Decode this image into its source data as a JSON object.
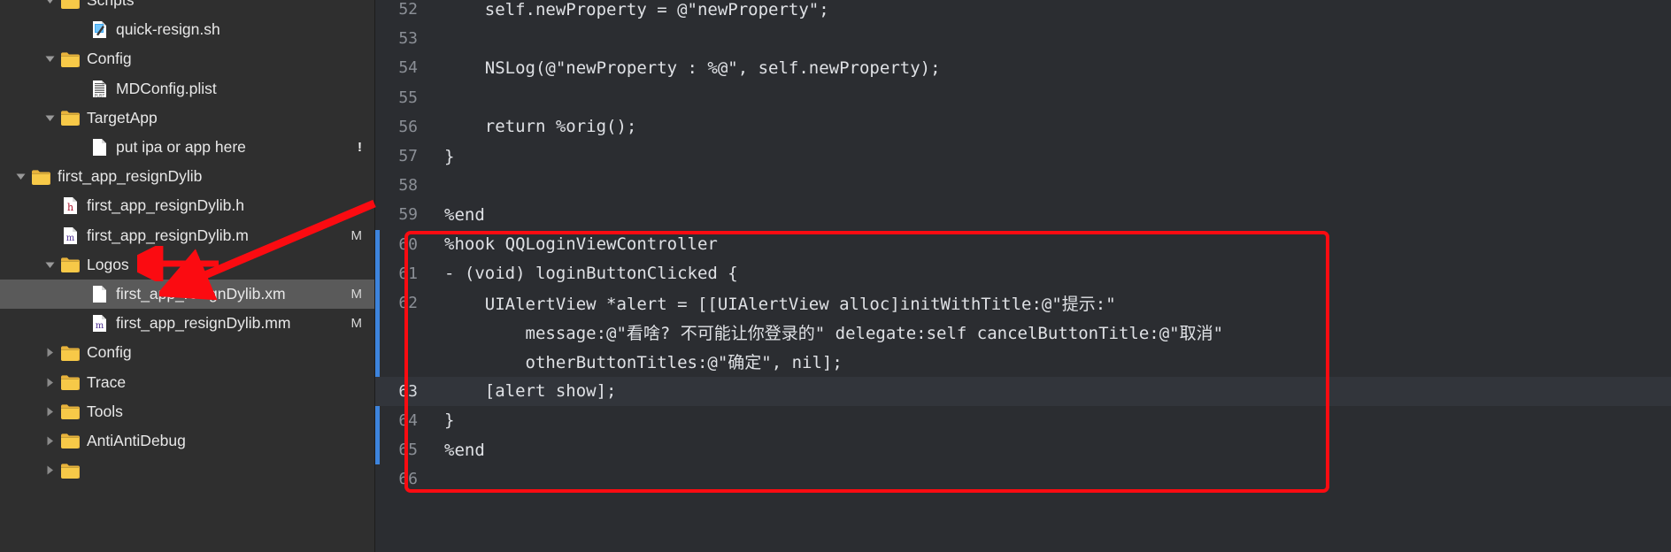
{
  "window": {
    "theme": "dark",
    "sidebar_bg": "#2f2f2f",
    "editor_bg": "#2b2d31",
    "accent_red": "#fb0b11",
    "accent_blue": "#3d84dd",
    "selection_bg": "#5a5a5a"
  },
  "sidebar": {
    "name": "project-file-tree",
    "items": [
      {
        "label": "Scripts",
        "indent": 1,
        "type": "folder",
        "twisty": "down",
        "icon": "folder-icon",
        "badge": "",
        "selected": false,
        "clipped_top": true
      },
      {
        "label": "quick-resign.sh",
        "indent": 2,
        "type": "file-sh",
        "twisty": "none",
        "icon": "shell-script-icon",
        "badge": "",
        "selected": false
      },
      {
        "label": "Config",
        "indent": 1,
        "type": "folder",
        "twisty": "down",
        "icon": "folder-icon",
        "badge": "",
        "selected": false
      },
      {
        "label": "MDConfig.plist",
        "indent": 2,
        "type": "file-plist",
        "twisty": "none",
        "icon": "plist-file-icon",
        "badge": "",
        "selected": false
      },
      {
        "label": "TargetApp",
        "indent": 1,
        "type": "folder",
        "twisty": "down",
        "icon": "folder-icon",
        "badge": "",
        "selected": false
      },
      {
        "label": "put ipa or app here",
        "indent": 2,
        "type": "file-plain",
        "twisty": "none",
        "icon": "blank-file-icon",
        "badge": "!",
        "selected": false
      },
      {
        "label": "first_app_resignDylib",
        "indent": 0,
        "type": "folder",
        "twisty": "down",
        "icon": "folder-icon",
        "badge": "",
        "selected": false
      },
      {
        "label": "first_app_resignDylib.h",
        "indent": 1,
        "type": "file-h",
        "twisty": "none",
        "icon": "header-file-icon",
        "badge": "",
        "selected": false
      },
      {
        "label": "first_app_resignDylib.m",
        "indent": 1,
        "type": "file-m",
        "twisty": "none",
        "icon": "objc-file-icon",
        "badge": "M",
        "selected": false
      },
      {
        "label": "Logos",
        "indent": 1,
        "type": "folder",
        "twisty": "down",
        "icon": "folder-icon",
        "badge": "",
        "selected": false
      },
      {
        "label": "first_app_resignDylib.xm",
        "indent": 2,
        "type": "file-plain",
        "twisty": "none",
        "icon": "blank-file-icon",
        "badge": "M",
        "selected": true
      },
      {
        "label": "first_app_resignDylib.mm",
        "indent": 2,
        "type": "file-mm",
        "twisty": "none",
        "icon": "objcpp-file-icon",
        "badge": "M",
        "selected": false
      },
      {
        "label": "Config",
        "indent": 1,
        "type": "folder",
        "twisty": "right",
        "icon": "folder-icon",
        "badge": "",
        "selected": false
      },
      {
        "label": "Trace",
        "indent": 1,
        "type": "folder",
        "twisty": "right",
        "icon": "folder-icon",
        "badge": "",
        "selected": false
      },
      {
        "label": "Tools",
        "indent": 1,
        "type": "folder",
        "twisty": "right",
        "icon": "folder-icon",
        "badge": "",
        "selected": false
      },
      {
        "label": "AntiAntiDebug",
        "indent": 1,
        "type": "folder",
        "twisty": "right",
        "icon": "folder-icon",
        "badge": "",
        "selected": false
      },
      {
        "label": "",
        "indent": 1,
        "type": "folder",
        "twisty": "right",
        "icon": "folder-icon",
        "badge": "",
        "selected": false,
        "clipped_bottom": true
      }
    ]
  },
  "editor": {
    "name": "source-code-editor",
    "language": "logos-objective-c",
    "lines": [
      {
        "num": "52",
        "text": "    self.newProperty = @\"newProperty\";",
        "current": false,
        "modified": false,
        "highlight": false,
        "wrapped": false
      },
      {
        "num": "53",
        "text": "",
        "current": false,
        "modified": false,
        "highlight": false,
        "wrapped": false
      },
      {
        "num": "54",
        "text": "    NSLog(@\"newProperty : %@\", self.newProperty);",
        "current": false,
        "modified": false,
        "highlight": false,
        "wrapped": false
      },
      {
        "num": "55",
        "text": "",
        "current": false,
        "modified": false,
        "highlight": false,
        "wrapped": false
      },
      {
        "num": "56",
        "text": "    return %orig();",
        "current": false,
        "modified": false,
        "highlight": false,
        "wrapped": false
      },
      {
        "num": "57",
        "text": "}",
        "current": false,
        "modified": false,
        "highlight": false,
        "wrapped": false
      },
      {
        "num": "58",
        "text": "",
        "current": false,
        "modified": false,
        "highlight": false,
        "wrapped": false
      },
      {
        "num": "59",
        "text": "%end",
        "current": false,
        "modified": false,
        "highlight": false,
        "wrapped": false
      },
      {
        "num": "60",
        "text": "%hook QQLoginViewController",
        "current": false,
        "modified": true,
        "highlight": false,
        "wrapped": false
      },
      {
        "num": "61",
        "text": "- (void) loginButtonClicked {",
        "current": false,
        "modified": true,
        "highlight": false,
        "wrapped": false
      },
      {
        "num": "62",
        "text": "    UIAlertView *alert = [[UIAlertView alloc]initWithTitle:@\"提示:\"",
        "current": false,
        "modified": true,
        "highlight": false,
        "wrapped": false
      },
      {
        "num": "",
        "text": "        message:@\"看啥? 不可能让你登录的\" delegate:self cancelButtonTitle:@\"取消\"",
        "current": false,
        "modified": true,
        "highlight": false,
        "wrapped": true
      },
      {
        "num": "",
        "text": "        otherButtonTitles:@\"确定\", nil];",
        "current": false,
        "modified": true,
        "highlight": false,
        "wrapped": true
      },
      {
        "num": "63",
        "text": "    [alert show];",
        "current": true,
        "modified": true,
        "highlight": true,
        "wrapped": false
      },
      {
        "num": "64",
        "text": "}",
        "current": false,
        "modified": true,
        "highlight": false,
        "wrapped": false
      },
      {
        "num": "65",
        "text": "%end",
        "current": false,
        "modified": true,
        "highlight": false,
        "wrapped": false
      },
      {
        "num": "66",
        "text": "",
        "current": false,
        "modified": false,
        "highlight": false,
        "wrapped": false
      }
    ]
  },
  "annotations": {
    "red_box": {
      "name": "highlight-rectangle",
      "label": "",
      "covers_lines": "60-66"
    },
    "red_arrow_long": {
      "name": "red-arrow-pointer",
      "points_to": "Logos"
    },
    "red_arrow_short": {
      "name": "red-arrow-pointer-short",
      "points_to": "Logos"
    }
  }
}
